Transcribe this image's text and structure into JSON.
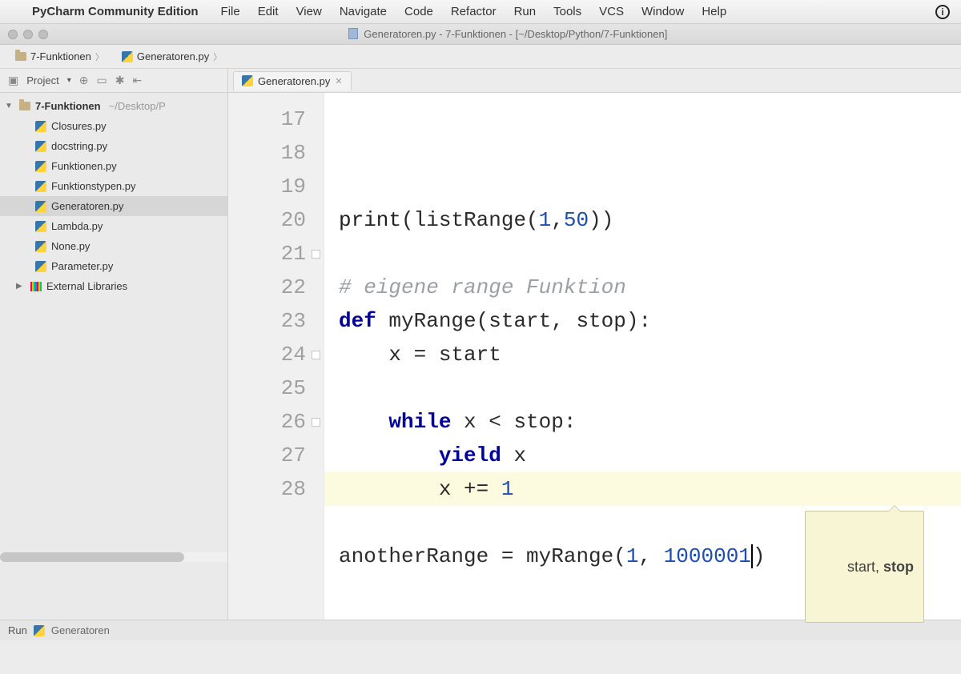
{
  "menubar": {
    "appname": "PyCharm Community Edition",
    "items": [
      "File",
      "Edit",
      "View",
      "Navigate",
      "Code",
      "Refactor",
      "Run",
      "Tools",
      "VCS",
      "Window",
      "Help"
    ]
  },
  "window": {
    "title": "Generatoren.py - 7-Funktionen - [~/Desktop/Python/7-Funktionen]"
  },
  "breadcrumbs": {
    "folder": "7-Funktionen",
    "file": "Generatoren.py"
  },
  "toolrow": {
    "project_label": "Project",
    "tab_label": "Generatoren.py"
  },
  "tree": {
    "root": "7-Funktionen",
    "root_path": "~/Desktop/P",
    "files": [
      "Closures.py",
      "docstring.py",
      "Funktionen.py",
      "Funktionstypen.py",
      "Generatoren.py",
      "Lambda.py",
      "None.py",
      "Parameter.py"
    ],
    "selected_index": 4,
    "external": "External Libraries"
  },
  "editor": {
    "first_line_no": 17,
    "line_count": 12,
    "current_line_index": 11,
    "hint_param1": "start, ",
    "hint_param2": "stop",
    "code": {
      "l17": "",
      "l18_a": "print",
      "l18_b": "(listRange(",
      "l18_c": "1",
      "l18_d": ",",
      "l18_e": "50",
      "l18_f": "))",
      "l19": "",
      "l20": "# eigene range Funktion",
      "l21_a": "def",
      "l21_b": " myRange(start, stop):",
      "l22": "    x = start",
      "l23": "",
      "l24_a": "    ",
      "l24_b": "while",
      "l24_c": " x < stop:",
      "l25_a": "        ",
      "l25_b": "yield",
      "l25_c": " x",
      "l26_a": "        x += ",
      "l26_b": "1",
      "l27": "",
      "l28_a": "anotherRange = myRange(",
      "l28_b": "1",
      "l28_c": ", ",
      "l28_d": "1000001",
      "l28_e": ")"
    }
  },
  "statusbar": {
    "run_label": "Run",
    "run_target": "Generatoren"
  }
}
